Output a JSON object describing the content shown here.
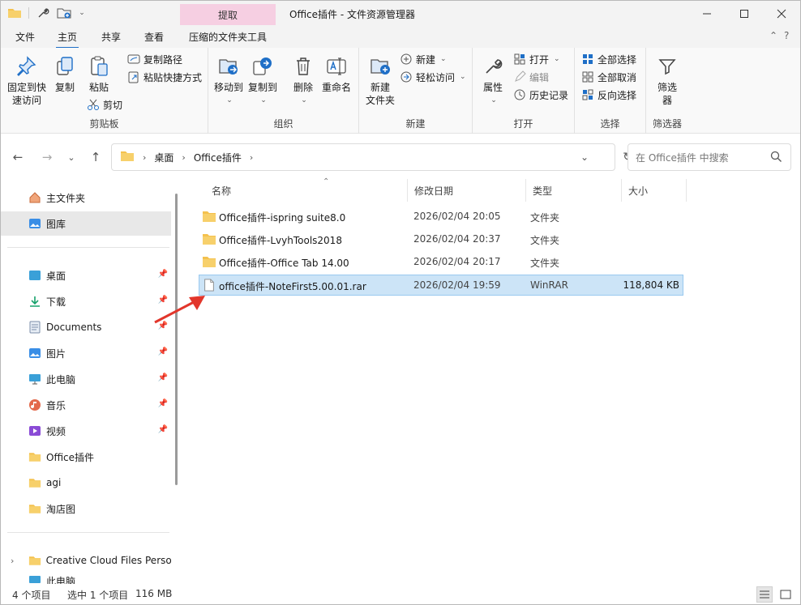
{
  "titlebar": {
    "context_tab": "提取",
    "title": "Office插件 - 文件资源管理器"
  },
  "tabs": {
    "file": "文件",
    "home": "主页",
    "share": "共享",
    "view": "查看",
    "compressed_tools": "压缩的文件夹工具"
  },
  "ribbon": {
    "clipboard": {
      "label": "剪贴板",
      "pin_quick_access": [
        "固定到快",
        "速访问"
      ],
      "copy": "复制",
      "paste": "粘贴",
      "copy_path": "复制路径",
      "paste_shortcut": "粘贴快捷方式",
      "cut": "剪切"
    },
    "organize": {
      "label": "组织",
      "move_to": "移动到",
      "copy_to": "复制到",
      "delete": "删除",
      "rename": "重命名"
    },
    "new": {
      "label": "新建",
      "new_folder": [
        "新建",
        "文件夹"
      ],
      "new_item": "新建",
      "easy_access": "轻松访问"
    },
    "open": {
      "label": "打开",
      "properties": "属性",
      "open": "打开",
      "edit": "编辑",
      "history": "历史记录"
    },
    "select": {
      "label": "选择",
      "select_all": "全部选择",
      "select_none": "全部取消",
      "invert": "反向选择"
    },
    "filter": {
      "label": "筛选器",
      "filter_btn": [
        "筛选",
        "器"
      ]
    }
  },
  "address": {
    "crumbs": [
      "桌面",
      "Office插件"
    ],
    "search_placeholder": "在 Office插件 中搜索"
  },
  "sidebar": {
    "top": [
      {
        "label": "主文件夹",
        "icon": "home-icon"
      },
      {
        "label": "图库",
        "icon": "gallery-icon"
      }
    ],
    "pinned": [
      {
        "label": "桌面",
        "icon": "desktop-icon"
      },
      {
        "label": "下载",
        "icon": "download-icon"
      },
      {
        "label": "Documents",
        "icon": "documents-icon"
      },
      {
        "label": "图片",
        "icon": "pictures-icon"
      },
      {
        "label": "此电脑",
        "icon": "pc-icon"
      },
      {
        "label": "音乐",
        "icon": "music-icon"
      },
      {
        "label": "视频",
        "icon": "videos-icon"
      }
    ],
    "folders": [
      {
        "label": "Office插件",
        "icon": "folder-icon"
      },
      {
        "label": "agi",
        "icon": "folder-icon"
      },
      {
        "label": "淘店图",
        "icon": "folder-icon"
      }
    ],
    "bottom": [
      {
        "label": "Creative Cloud Files Persor",
        "icon": "folder-icon"
      },
      {
        "label": "此电脑",
        "icon": "pc-icon"
      }
    ]
  },
  "filelist": {
    "columns": {
      "name": "名称",
      "date": "修改日期",
      "type": "类型",
      "size": "大小"
    },
    "rows": [
      {
        "name": "Office插件-ispring suite8.0",
        "date": "2026/02/04 20:05",
        "type": "文件夹",
        "size": "",
        "kind": "folder"
      },
      {
        "name": "Office插件-LvyhTools2018",
        "date": "2026/02/04 20:37",
        "type": "文件夹",
        "size": "",
        "kind": "folder"
      },
      {
        "name": "Office插件-Office Tab 14.00",
        "date": "2026/02/04 20:17",
        "type": "文件夹",
        "size": "",
        "kind": "folder"
      },
      {
        "name": "office插件-NoteFirst5.00.01.rar",
        "date": "2026/02/04 19:59",
        "type": "WinRAR",
        "size": "118,804 KB",
        "kind": "file"
      }
    ]
  },
  "statusbar": {
    "count": "4 个项目",
    "selection": "选中 1 个项目",
    "size": "116 MB"
  },
  "colors": {
    "accent": "#1f6fc7",
    "folder": "#f4c14e",
    "selection": "#cce4f7",
    "context_tab": "#f6cfe2",
    "arrow": "#e2362b"
  }
}
